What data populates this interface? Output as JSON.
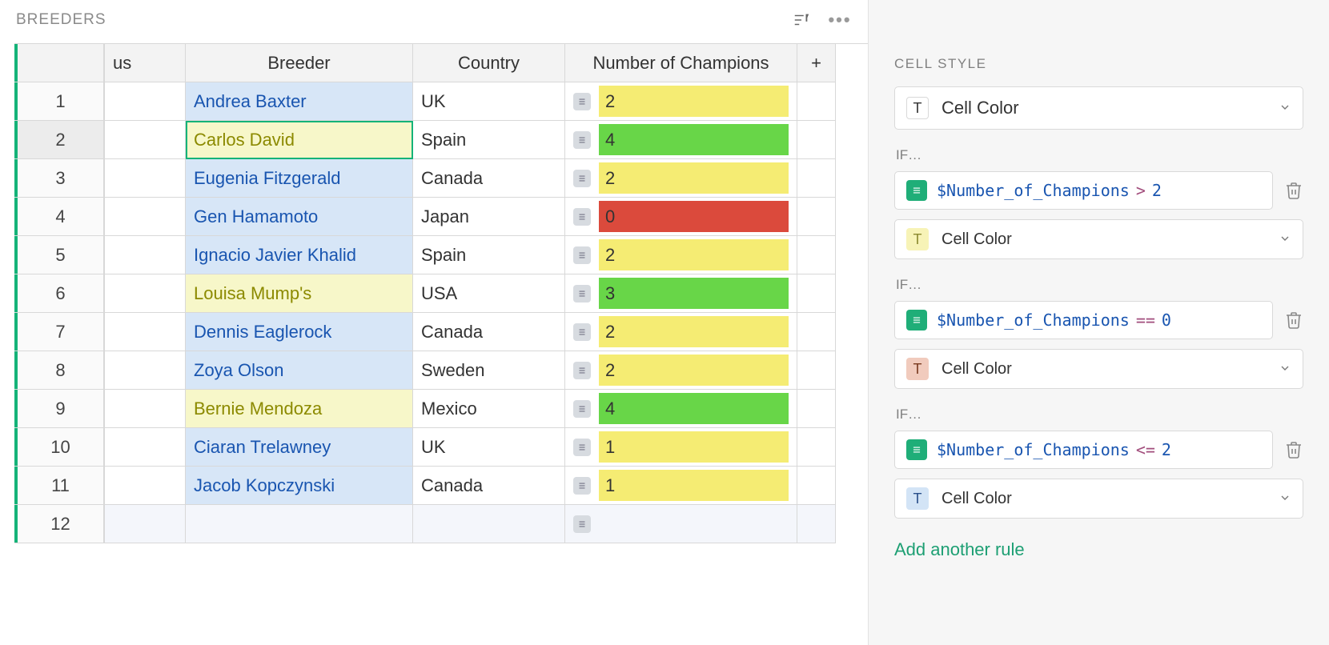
{
  "table": {
    "title": "BREEDERS",
    "columns": {
      "truncated": "us",
      "breeder": "Breeder",
      "country": "Country",
      "champions": "Number of Champions",
      "add": "+"
    },
    "rows": [
      {
        "n": "1",
        "breeder": "Andrea Baxter",
        "bstyle": "blue",
        "country": "UK",
        "champ": "2",
        "cstyle": "yellow"
      },
      {
        "n": "2",
        "breeder": "Carlos David",
        "bstyle": "yellow",
        "country": "Spain",
        "champ": "4",
        "cstyle": "green",
        "selected": true
      },
      {
        "n": "3",
        "breeder": "Eugenia Fitzgerald",
        "bstyle": "blue",
        "country": "Canada",
        "champ": "2",
        "cstyle": "yellow"
      },
      {
        "n": "4",
        "breeder": "Gen Hamamoto",
        "bstyle": "blue",
        "country": "Japan",
        "champ": "0",
        "cstyle": "red"
      },
      {
        "n": "5",
        "breeder": "Ignacio Javier Khalid",
        "bstyle": "blue",
        "country": "Spain",
        "champ": "2",
        "cstyle": "yellow"
      },
      {
        "n": "6",
        "breeder": "Louisa Mump's",
        "bstyle": "yellow",
        "country": "USA",
        "champ": "3",
        "cstyle": "green"
      },
      {
        "n": "7",
        "breeder": "Dennis Eaglerock",
        "bstyle": "blue",
        "country": "Canada",
        "champ": "2",
        "cstyle": "yellow"
      },
      {
        "n": "8",
        "breeder": "Zoya Olson",
        "bstyle": "blue",
        "country": "Sweden",
        "champ": "2",
        "cstyle": "yellow"
      },
      {
        "n": "9",
        "breeder": "Bernie Mendoza",
        "bstyle": "yellow",
        "country": "Mexico",
        "champ": "4",
        "cstyle": "green"
      },
      {
        "n": "10",
        "breeder": "Ciaran Trelawney",
        "bstyle": "blue",
        "country": "UK",
        "champ": "1",
        "cstyle": "yellow"
      },
      {
        "n": "11",
        "breeder": "Jacob Kopczynski",
        "bstyle": "blue",
        "country": "Canada",
        "champ": "1",
        "cstyle": "yellow"
      },
      {
        "n": "12",
        "breeder": "",
        "bstyle": "new",
        "country": "",
        "champ": "",
        "cstyle": "new"
      }
    ]
  },
  "side": {
    "section": "CELL STYLE",
    "default_select": "Cell Color",
    "if_label": "IF…",
    "rules": [
      {
        "var": "$Number_of_Champions",
        "op": ">",
        "num": "2",
        "swatch": "yellow",
        "select": "Cell Color"
      },
      {
        "var": "$Number_of_Champions",
        "op": "==",
        "num": "0",
        "swatch": "red",
        "select": "Cell Color"
      },
      {
        "var": "$Number_of_Champions",
        "op": "<=",
        "num": "2",
        "swatch": "blue",
        "select": "Cell Color"
      }
    ],
    "add_rule": "Add another rule"
  }
}
